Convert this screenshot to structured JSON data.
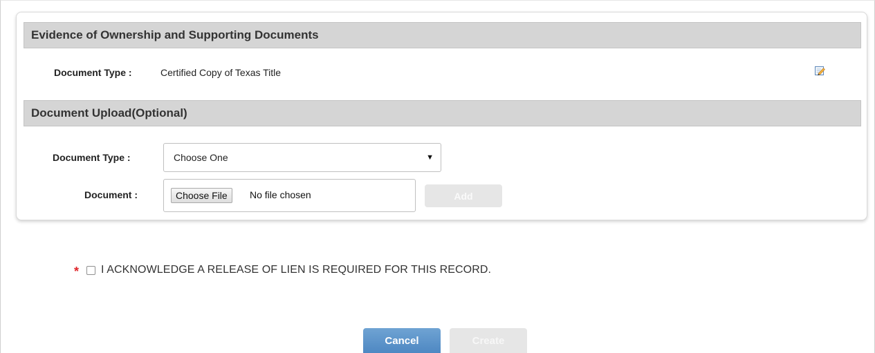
{
  "ownership_section": {
    "title": "Evidence of Ownership and Supporting Documents",
    "document_type_label": "Document Type :",
    "document_type_value": "Certified Copy of Texas Title",
    "edit_icon": "edit-pencil-icon"
  },
  "upload_section": {
    "title": "Document Upload(Optional)",
    "document_type_label": "Document Type :",
    "document_type_selected": "Choose One",
    "document_label": "Document :",
    "choose_file_label": "Choose File",
    "file_status": "No file chosen",
    "add_label": "Add"
  },
  "acknowledgement": {
    "required_marker": "*",
    "text": "I ACKNOWLEDGE A RELEASE OF LIEN IS REQUIRED FOR THIS RECORD.",
    "checked": false
  },
  "actions": {
    "cancel_label": "Cancel",
    "create_label": "Create"
  },
  "colors": {
    "section_header_bg": "#d5d5d5",
    "primary_button": "#5a93c9",
    "disabled_button": "#e6e6e6",
    "required_red": "#e0262b"
  }
}
